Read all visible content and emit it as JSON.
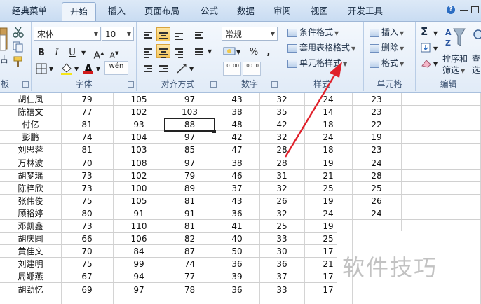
{
  "tabs": [
    "经典菜单",
    "开始",
    "插入",
    "页面布局",
    "公式",
    "数据",
    "审阅",
    "视图",
    "开发工具"
  ],
  "active_tab": "开始",
  "help_label": "?",
  "font_group": {
    "label": "字体",
    "font_name": "宋体",
    "font_size": "10",
    "bold": "B",
    "italic": "I",
    "underline": "U",
    "grow": "A",
    "shrink": "A",
    "font_color_glyph": "A",
    "phonetic": "wén"
  },
  "clipboard_group": {
    "label": "板",
    "paste_fragment": "占"
  },
  "align_group": {
    "label": "对齐方式"
  },
  "number_group": {
    "label": "数字",
    "format": "常规",
    "percent": "%",
    "comma": ",",
    "inc_decimal": ".0 .00",
    "dec_decimal": ".00 .0"
  },
  "style_group": {
    "label": "样式",
    "conditional": "条件格式",
    "table_format": "套用表格格式",
    "cell_style": "单元格样式"
  },
  "cells_group": {
    "label": "单元格",
    "insert": "插入",
    "delete": "删除",
    "format": "格式"
  },
  "edit_group": {
    "label": "编辑",
    "sum": "Σ",
    "sort_filter_1": "排序和",
    "sort_filter_2": "筛选",
    "find_1": "查",
    "find_2": "选",
    "az": "AZ"
  },
  "annotation_color": "#e0202a",
  "accent": "#f7c85a",
  "rows": [
    [
      "胡仁凤",
      "79",
      "105",
      "97",
      "43",
      "32",
      "24",
      "23"
    ],
    [
      "陈禧文",
      "77",
      "102",
      "103",
      "38",
      "35",
      "14",
      "23"
    ],
    [
      "付亿",
      "81",
      "93",
      "88",
      "48",
      "42",
      "18",
      "22"
    ],
    [
      "彭鹏",
      "74",
      "104",
      "97",
      "42",
      "32",
      "24",
      "19"
    ],
    [
      "刘思蓉",
      "81",
      "103",
      "85",
      "47",
      "28",
      "18",
      "23"
    ],
    [
      "万林波",
      "70",
      "108",
      "97",
      "38",
      "28",
      "19",
      "24"
    ],
    [
      "胡梦瑶",
      "73",
      "102",
      "79",
      "46",
      "31",
      "21",
      "28"
    ],
    [
      "陈梓欣",
      "73",
      "100",
      "89",
      "37",
      "32",
      "25",
      "25"
    ],
    [
      "张伟俊",
      "75",
      "105",
      "81",
      "43",
      "26",
      "19",
      "26"
    ],
    [
      "顾裕婷",
      "80",
      "91",
      "91",
      "36",
      "32",
      "24",
      "24"
    ],
    [
      "邓凯鑫",
      "73",
      "110",
      "81",
      "41",
      "25",
      "19",
      ""
    ],
    [
      "胡庆圆",
      "66",
      "106",
      "82",
      "40",
      "33",
      "25",
      ""
    ],
    [
      "黄佳文",
      "70",
      "84",
      "87",
      "50",
      "30",
      "17",
      ""
    ],
    [
      "刘建明",
      "75",
      "99",
      "74",
      "36",
      "36",
      "21",
      ""
    ],
    [
      "周娜燕",
      "67",
      "94",
      "77",
      "39",
      "37",
      "17",
      ""
    ],
    [
      "胡劲忆",
      "69",
      "97",
      "78",
      "36",
      "33",
      "17",
      ""
    ]
  ],
  "watermark": "软件技巧"
}
